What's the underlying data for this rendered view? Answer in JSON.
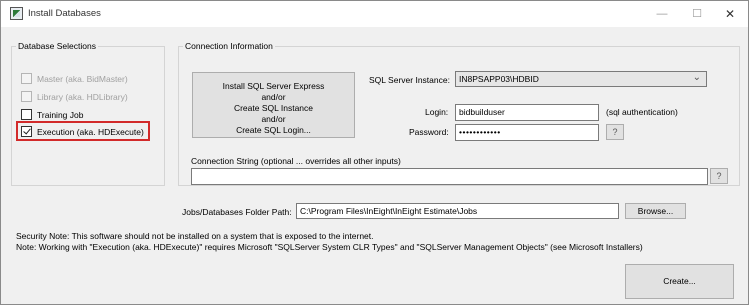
{
  "window": {
    "title": "Install Databases",
    "minimize_icon": "—",
    "maximize_icon": "☐",
    "close_icon": "✕"
  },
  "db_selections": {
    "legend": "Database Selections",
    "items": [
      {
        "label": "Master (aka. BidMaster)",
        "checked": false,
        "enabled": false
      },
      {
        "label": "Library (aka. HDLibrary)",
        "checked": false,
        "enabled": false
      },
      {
        "label": "Training Job",
        "checked": false,
        "enabled": true
      },
      {
        "label": "Execution (aka. HDExecute)",
        "checked": true,
        "enabled": true
      }
    ],
    "highlight_color": "#d22a2a"
  },
  "connection": {
    "legend": "Connection Information",
    "install_button": "Install SQL Server Express\nand/or\nCreate SQL Instance\nand/or\nCreate SQL Login...",
    "instance_label": "SQL Server Instance:",
    "instance_value": "IN8PSAPP03\\HDBID",
    "login_label": "Login:",
    "login_value": "bidbuilduser",
    "login_note": "(sql authentication)",
    "password_label": "Password:",
    "password_value": "••••••••••••",
    "help_button": "?",
    "conn_string_label": "Connection String (optional ... overrides all other inputs)",
    "conn_string_value": "",
    "conn_help_button": "?"
  },
  "jobs": {
    "label": "Jobs/Databases Folder Path:",
    "value": "C:\\Program Files\\InEight\\InEight Estimate\\Jobs",
    "browse_button": "Browse..."
  },
  "notes": {
    "security": "Security Note: This software should not be installed on a system that is exposed to the internet.",
    "execution": "Note: Working with \"Execution (aka. HDExecute)\" requires Microsoft \"SQLServer System CLR Types\" and \"SQLServer Management Objects\" (see Microsoft Installers)"
  },
  "create_button": "Create..."
}
